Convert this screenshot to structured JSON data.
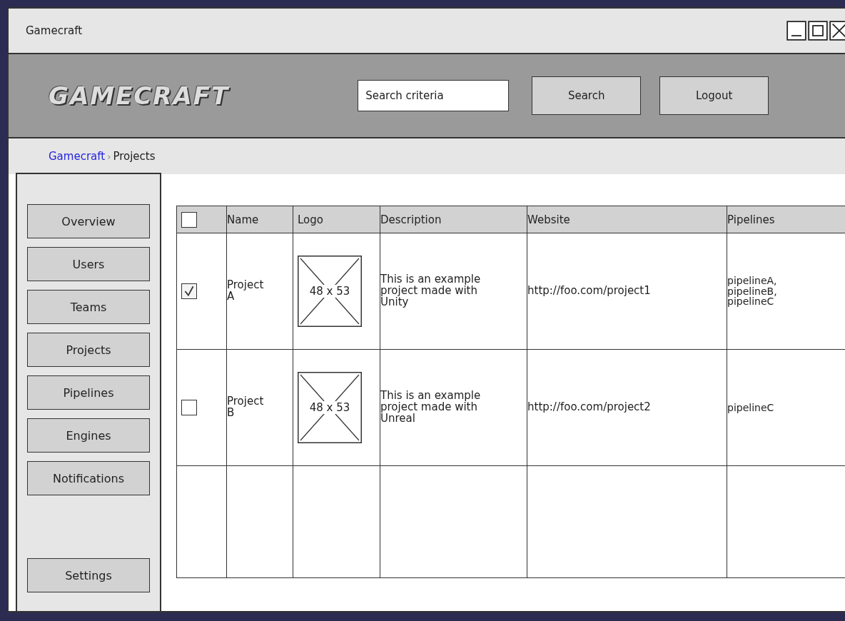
{
  "window": {
    "title": "Gamecraft"
  },
  "header": {
    "logo": "GAMECRAFT",
    "search": {
      "placeholder": "Search criteria"
    },
    "buttons": [
      "Search",
      "Logout"
    ]
  },
  "breadcrumb_separator": "›",
  "breadcrumb": [
    {
      "label": "Gamecraft",
      "link": true
    },
    {
      "label": "Projects",
      "link": false
    }
  ],
  "sidebar": {
    "items": [
      "Overview",
      "Users",
      "Teams",
      "Projects",
      "Pipelines",
      "Engines",
      "Notifications"
    ],
    "footer_item": "Settings"
  },
  "table": {
    "header_checked": false,
    "columns": [
      "Name",
      "Logo",
      "Description",
      "Website",
      "Pipelines"
    ],
    "rows": [
      {
        "checked": true,
        "name": "Project A",
        "logo": "48 x 53",
        "description": "This is an example project made with Unity",
        "website": "http://foo.com/project1",
        "pipelines": [
          "pipelineA,",
          "pipelineB,",
          "pipelineC"
        ]
      },
      {
        "checked": false,
        "name": "Project B",
        "logo": "48 x 53",
        "description": "This is an example project made with Unreal",
        "website": "http://foo.com/project2",
        "pipelines": [
          "pipelineC"
        ]
      }
    ]
  }
}
